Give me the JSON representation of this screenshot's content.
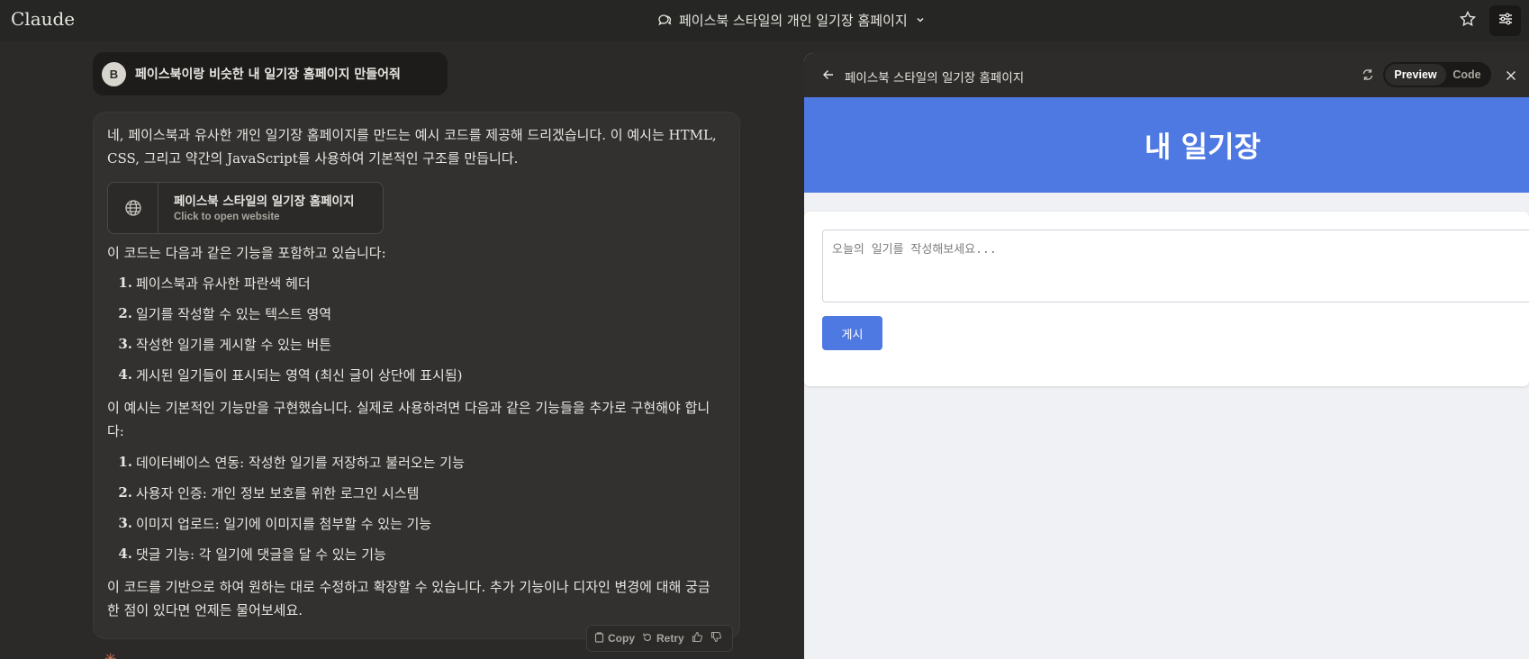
{
  "app": {
    "logo": "Claude",
    "conversation_title": "페이스북 스타일의 개인 일기장 홈페이지"
  },
  "user_message": {
    "avatar_initial": "B",
    "text": "페이스북이랑 비슷한 내 일기장 홈페이지 만들어줘"
  },
  "assistant": {
    "intro": "네, 페이스북과 유사한 개인 일기장 홈페이지를 만드는 예시 코드를 제공해 드리겠습니다. 이 예시는 HTML, CSS, 그리고 약간의 JavaScript를 사용하여 기본적인 구조를 만듭니다.",
    "artifact_card": {
      "title": "페이스북 스타일의 일기장 홈페이지",
      "subtitle": "Click to open website"
    },
    "features_intro": "이 코드는 다음과 같은 기능을 포함하고 있습니다:",
    "features": [
      {
        "num": "1.",
        "text": "페이스북과 유사한 파란색 헤더"
      },
      {
        "num": "2.",
        "text": "일기를 작성할 수 있는 텍스트 영역"
      },
      {
        "num": "3.",
        "text": "작성한 일기를 게시할 수 있는 버튼"
      },
      {
        "num": "4.",
        "text": "게시된 일기들이 표시되는 영역 (최신 글이 상단에 표시됨)"
      }
    ],
    "todo_intro": "이 예시는 기본적인 기능만을 구현했습니다. 실제로 사용하려면 다음과 같은 기능들을 추가로 구현해야 합니다:",
    "todos": [
      {
        "num": "1.",
        "text": "데이터베이스 연동: 작성한 일기를 저장하고 불러오는 기능"
      },
      {
        "num": "2.",
        "text": "사용자 인증: 개인 정보 보호를 위한 로그인 시스템"
      },
      {
        "num": "3.",
        "text": "이미지 업로드: 일기에 이미지를 첨부할 수 있는 기능"
      },
      {
        "num": "4.",
        "text": "댓글 기능: 각 일기에 댓글을 달 수 있는 기능"
      }
    ],
    "outro": "이 코드를 기반으로 하여 원하는 대로 수정하고 확장할 수 있습니다. 추가 기능이나 디자인 변경에 대해 궁금한 점이 있다면 언제든 물어보세요.",
    "actions": {
      "copy": "Copy",
      "retry": "Retry"
    }
  },
  "artifact_panel": {
    "title": "페이스북 스타일의 일기장 홈페이지",
    "tabs": {
      "preview": "Preview",
      "code": "Code"
    },
    "active_tab": "preview",
    "site": {
      "header_title": "내 일기장",
      "input_placeholder": "오늘의 일기를 작성해보세요...",
      "post_button": "게시"
    }
  },
  "colors": {
    "site_blue": "#4e78e2",
    "app_bg": "#2b2a28",
    "accent_orange": "#d97757"
  }
}
